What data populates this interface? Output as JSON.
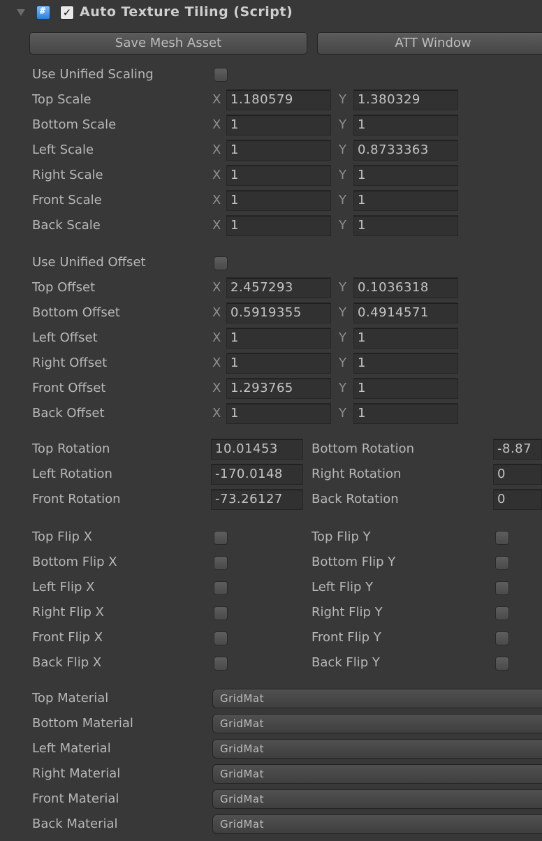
{
  "header": {
    "title": "Auto Texture Tiling (Script)",
    "enabled": true
  },
  "buttons": {
    "save_mesh": "Save Mesh Asset",
    "att_window": "ATT Window"
  },
  "use_unified_scaling_label": "Use Unified Scaling",
  "scale_rows": [
    {
      "label": "Top Scale",
      "x": "1.180579",
      "y": "1.380329"
    },
    {
      "label": "Bottom Scale",
      "x": "1",
      "y": "1"
    },
    {
      "label": "Left Scale",
      "x": "1",
      "y": "0.8733363"
    },
    {
      "label": "Right Scale",
      "x": "1",
      "y": "1"
    },
    {
      "label": "Front Scale",
      "x": "1",
      "y": "1"
    },
    {
      "label": "Back Scale",
      "x": "1",
      "y": "1"
    }
  ],
  "use_unified_offset_label": "Use Unified Offset",
  "offset_rows": [
    {
      "label": "Top Offset",
      "x": "2.457293",
      "y": "0.1036318"
    },
    {
      "label": "Bottom Offset",
      "x": "0.5919355",
      "y": "0.4914571"
    },
    {
      "label": "Left Offset",
      "x": "1",
      "y": "1"
    },
    {
      "label": "Right Offset",
      "x": "1",
      "y": "1"
    },
    {
      "label": "Front Offset",
      "x": "1.293765",
      "y": "1"
    },
    {
      "label": "Back Offset",
      "x": "1",
      "y": "1"
    }
  ],
  "axis_labels": {
    "x": "X",
    "y": "Y"
  },
  "rotation_rows": [
    {
      "label_a": "Top Rotation",
      "value_a": "10.01453",
      "label_b": "Bottom Rotation",
      "value_b": "-8.87"
    },
    {
      "label_a": "Left Rotation",
      "value_a": "-170.0148",
      "label_b": "Right Rotation",
      "value_b": "0"
    },
    {
      "label_a": "Front Rotation",
      "value_a": "-73.26127",
      "label_b": "Back Rotation",
      "value_b": "0"
    }
  ],
  "flip_rows": [
    {
      "label_a": "Top Flip X",
      "label_b": "Top Flip Y"
    },
    {
      "label_a": "Bottom Flip X",
      "label_b": "Bottom Flip Y"
    },
    {
      "label_a": "Left Flip X",
      "label_b": "Left Flip Y"
    },
    {
      "label_a": "Right Flip X",
      "label_b": "Right Flip Y"
    },
    {
      "label_a": "Front Flip X",
      "label_b": "Front Flip Y"
    },
    {
      "label_a": "Back Flip X",
      "label_b": "Back Flip Y"
    }
  ],
  "material_rows": [
    {
      "label": "Top Material",
      "value": "GridMat"
    },
    {
      "label": "Bottom Material",
      "value": "GridMat"
    },
    {
      "label": "Left Material",
      "value": "GridMat"
    },
    {
      "label": "Right Material",
      "value": "GridMat"
    },
    {
      "label": "Front Material",
      "value": "GridMat"
    },
    {
      "label": "Back Material",
      "value": "GridMat"
    }
  ]
}
